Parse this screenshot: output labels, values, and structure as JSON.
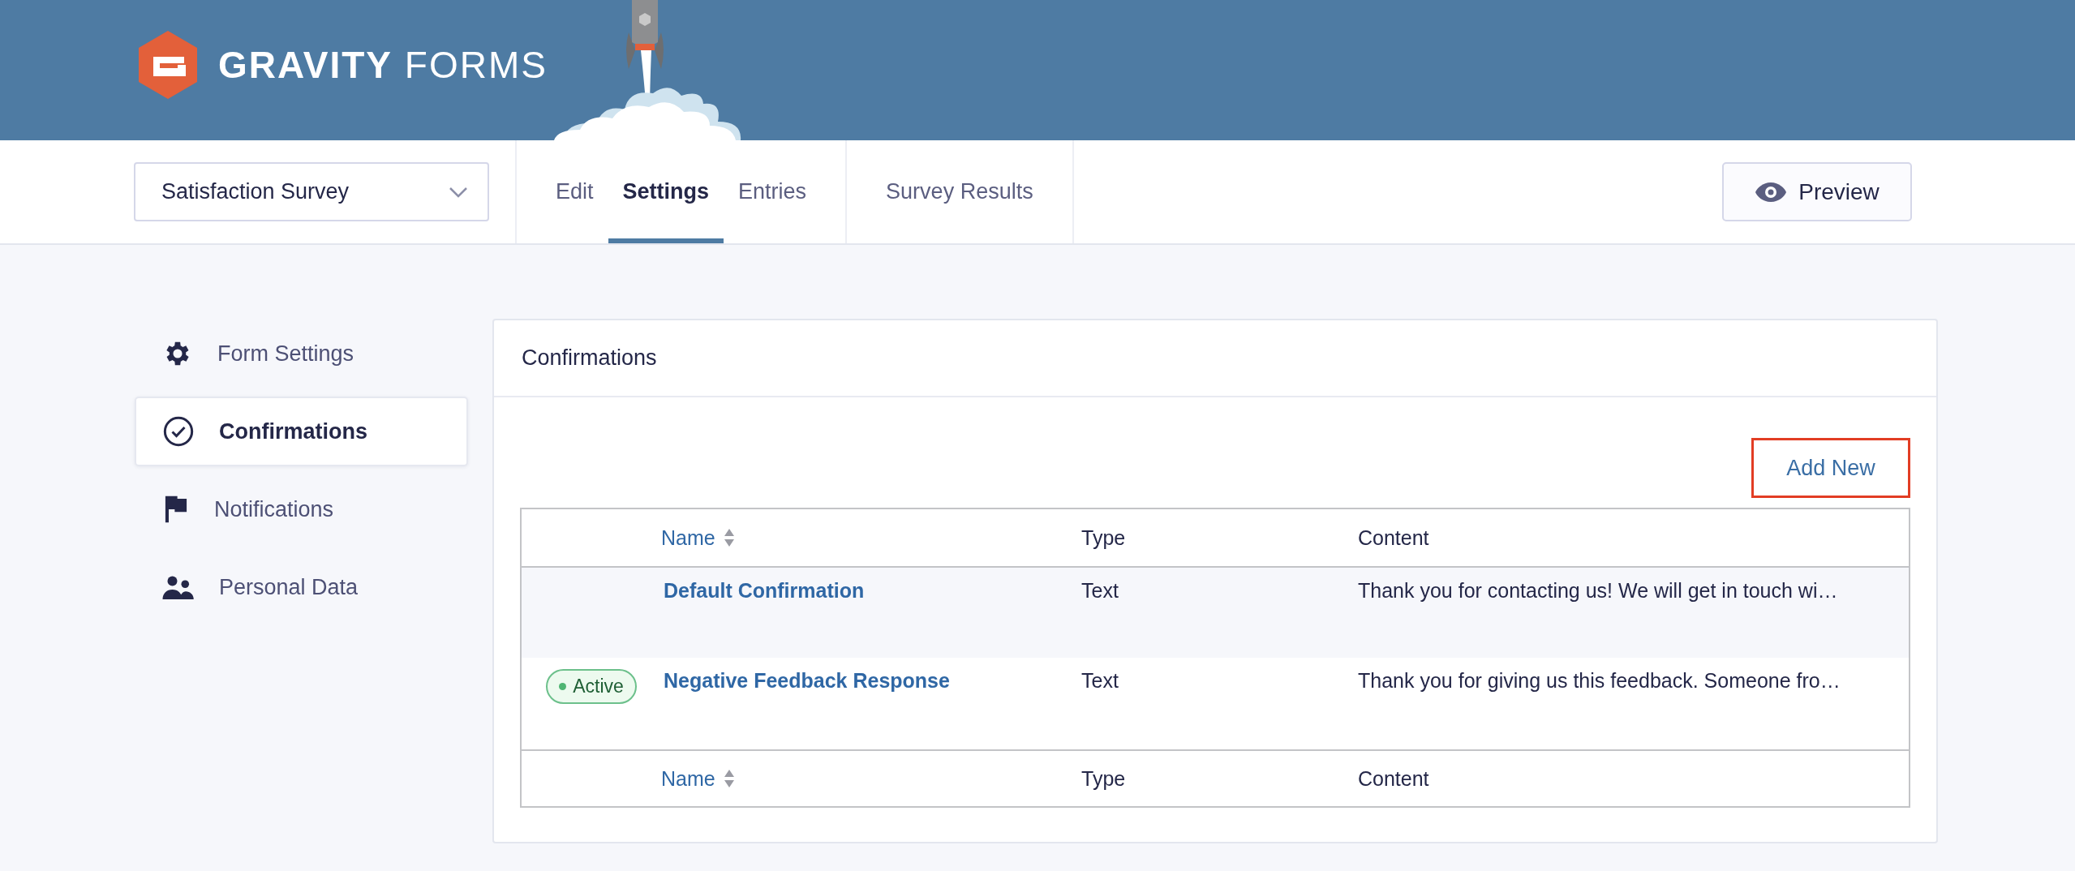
{
  "header": {
    "logo_text": "**GRAVITY** FORMS"
  },
  "form_selector": {
    "value": "Satisfaction Survey"
  },
  "tab_groups": [
    {
      "tabs": [
        {
          "label": "Edit",
          "selected": false
        },
        {
          "label": "Settings",
          "selected": true
        },
        {
          "label": "Entries",
          "selected": false
        }
      ]
    },
    {
      "tabs": [
        {
          "label": "Survey Results",
          "selected": false
        }
      ]
    }
  ],
  "preview_button": {
    "label": "Preview"
  },
  "sidebar": {
    "items": [
      {
        "label": "Form Settings",
        "kind": "gear",
        "selected": false
      },
      {
        "label": "Confirmations",
        "kind": "check",
        "selected": true
      },
      {
        "label": "Notifications",
        "kind": "flag",
        "selected": false
      },
      {
        "label": "Personal Data",
        "kind": "people",
        "selected": false
      }
    ]
  },
  "panel": {
    "title": "Confirmations",
    "add_new": {
      "label": "Add New",
      "highlighted": true
    },
    "table": {
      "columns": [
        "Name",
        "Type",
        "Content"
      ],
      "rows": [
        {
          "status": null,
          "name": "Default Confirmation",
          "type": "Text",
          "content": "Thank you for contacting us! We will get in touch wi…"
        },
        {
          "status": "Active",
          "name": "Negative Feedback Response",
          "type": "Text",
          "content": "Thank you for giving us this feedback. Someone fro…"
        }
      ],
      "footer_columns": [
        "Name",
        "Type",
        "Content"
      ]
    }
  }
}
